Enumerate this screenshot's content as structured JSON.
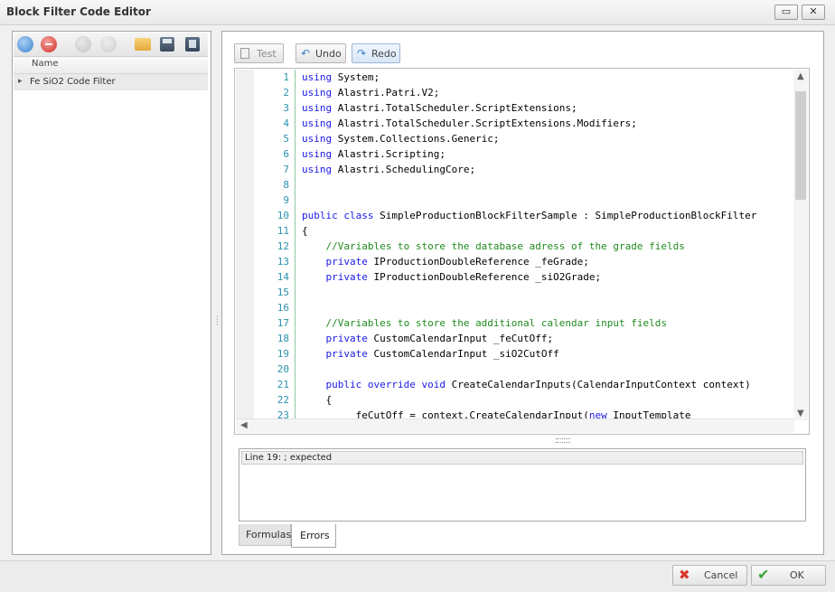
{
  "window": {
    "title": "Block Filter Code Editor",
    "restore_glyph": "▭",
    "close_glyph": "✕"
  },
  "left_toolbar": {
    "icons": [
      "add-icon",
      "delete-icon",
      "move-down-icon",
      "move-up-icon",
      "open-folder-icon",
      "save-icon",
      "copy-icon"
    ]
  },
  "filter_list": {
    "column_header": "Name",
    "rows": [
      {
        "expander": "▸",
        "label": "Fe SiO2 Code Filter"
      }
    ]
  },
  "editor_toolbar": {
    "test_label": "Test",
    "undo_label": "Undo",
    "redo_label": "Redo"
  },
  "editor": {
    "line_numbers": [
      "1",
      "2",
      "3",
      "4",
      "5",
      "6",
      "7",
      "8",
      "9",
      "10",
      "11",
      "12",
      "13",
      "14",
      "15",
      "16",
      "17",
      "18",
      "19",
      "20",
      "21",
      "22",
      "23"
    ],
    "lines": [
      [
        {
          "t": "using",
          "k": "kw"
        },
        {
          "t": " System;"
        }
      ],
      [
        {
          "t": "using",
          "k": "kw"
        },
        {
          "t": " Alastri.Patri.V2;"
        }
      ],
      [
        {
          "t": "using",
          "k": "kw"
        },
        {
          "t": " Alastri.TotalScheduler.ScriptExtensions;"
        }
      ],
      [
        {
          "t": "using",
          "k": "kw"
        },
        {
          "t": " Alastri.TotalScheduler.ScriptExtensions.Modifiers;"
        }
      ],
      [
        {
          "t": "using",
          "k": "kw"
        },
        {
          "t": " System.Collections.Generic;"
        }
      ],
      [
        {
          "t": "using",
          "k": "kw"
        },
        {
          "t": " Alastri.Scripting;"
        }
      ],
      [
        {
          "t": "using",
          "k": "kw"
        },
        {
          "t": " Alastri.SchedulingCore;"
        }
      ],
      [
        {
          "t": ""
        }
      ],
      [
        {
          "t": ""
        }
      ],
      [
        {
          "t": "public class",
          "k": "kw"
        },
        {
          "t": " SimpleProductionBlockFilterSample : SimpleProductionBlockFilter"
        }
      ],
      [
        {
          "t": "{"
        }
      ],
      [
        {
          "t": "    "
        },
        {
          "t": "//Variables to store the database adress of the grade fields",
          "k": "cm"
        }
      ],
      [
        {
          "t": "    "
        },
        {
          "t": "private",
          "k": "kw"
        },
        {
          "t": " IProductionDoubleReference _feGrade;"
        }
      ],
      [
        {
          "t": "    "
        },
        {
          "t": "private",
          "k": "kw"
        },
        {
          "t": " IProductionDoubleReference _siO2Grade;"
        }
      ],
      [
        {
          "t": ""
        }
      ],
      [
        {
          "t": ""
        }
      ],
      [
        {
          "t": "    "
        },
        {
          "t": "//Variables to store the additional calendar input fields",
          "k": "cm"
        }
      ],
      [
        {
          "t": "    "
        },
        {
          "t": "private",
          "k": "kw"
        },
        {
          "t": " CustomCalendarInput _feCutOff;"
        }
      ],
      [
        {
          "t": "    "
        },
        {
          "t": "private",
          "k": "kw"
        },
        {
          "t": " CustomCalendarInput _siO2CutOff"
        }
      ],
      [
        {
          "t": ""
        }
      ],
      [
        {
          "t": "    "
        },
        {
          "t": "public override void",
          "k": "kw"
        },
        {
          "t": " CreateCalendarInputs(CalendarInputContext context)"
        }
      ],
      [
        {
          "t": "    {"
        }
      ],
      [
        {
          "t": "        _feCutOff = context.CreateCalendarInput("
        },
        {
          "t": "new",
          "k": "kw"
        },
        {
          "t": " InputTemplate"
        }
      ]
    ]
  },
  "errors": {
    "rows": [
      "Line 19:  ; expected"
    ]
  },
  "tabs": [
    {
      "label": "Formulas",
      "active": false
    },
    {
      "label": "Errors",
      "active": true
    }
  ],
  "footer": {
    "cancel_label": "Cancel",
    "ok_label": "OK"
  },
  "colors": {
    "accent_blue": "#4a90d9",
    "delete_red": "#d9362a",
    "ok_green": "#3aa53a",
    "keyword": "#1a1ae8",
    "comment": "#1f8b1f",
    "line_number": "#2b91af"
  }
}
